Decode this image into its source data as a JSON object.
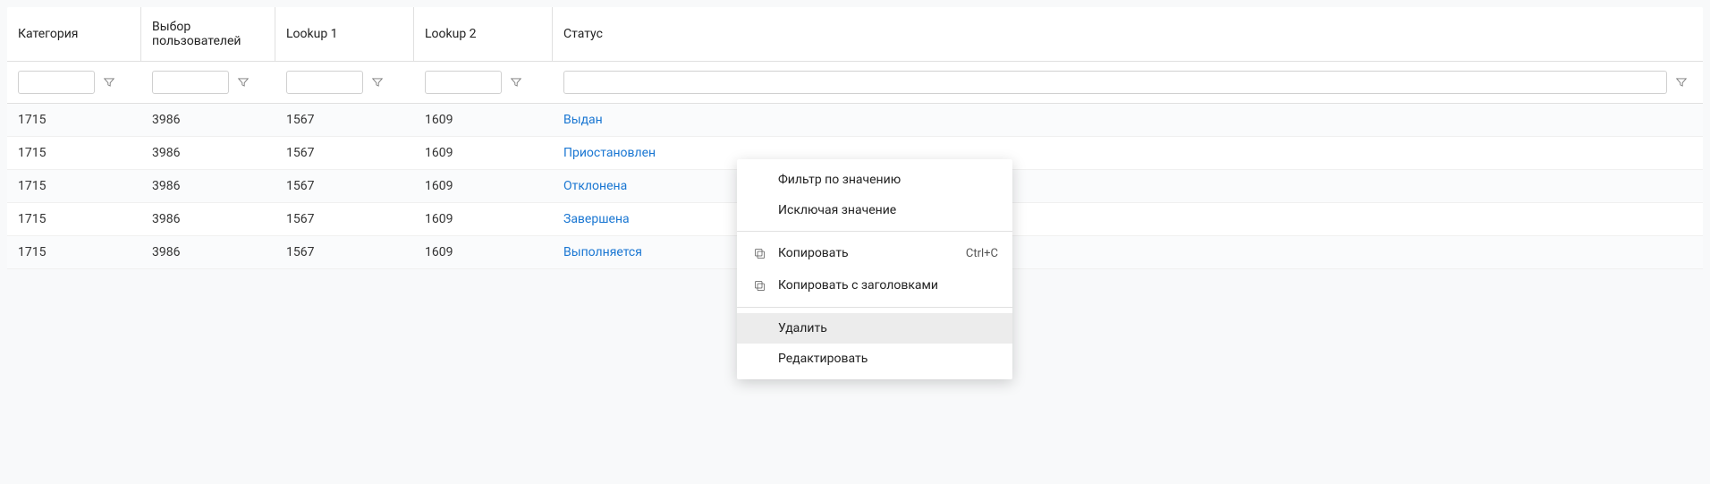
{
  "columns": [
    {
      "label": "Категория"
    },
    {
      "label": "Выбор пользователей"
    },
    {
      "label": "Lookup 1"
    },
    {
      "label": "Lookup 2"
    },
    {
      "label": "Статус"
    }
  ],
  "rows": [
    {
      "category": "1715",
      "users": "3986",
      "lookup1": "1567",
      "lookup2": "1609",
      "status": "Выдан"
    },
    {
      "category": "1715",
      "users": "3986",
      "lookup1": "1567",
      "lookup2": "1609",
      "status": "Приостановлен"
    },
    {
      "category": "1715",
      "users": "3986",
      "lookup1": "1567",
      "lookup2": "1609",
      "status": "Отклонена"
    },
    {
      "category": "1715",
      "users": "3986",
      "lookup1": "1567",
      "lookup2": "1609",
      "status": "Завершена"
    },
    {
      "category": "1715",
      "users": "3986",
      "lookup1": "1567",
      "lookup2": "1609",
      "status": "Выполняется"
    }
  ],
  "context_menu": {
    "filter_by_value": "Фильтр по значению",
    "filter_exclude": "Исключая значение",
    "copy": "Копировать",
    "copy_shortcut": "Ctrl+C",
    "copy_with_headers": "Копировать с заголовками",
    "delete": "Удалить",
    "edit": "Редактировать"
  }
}
